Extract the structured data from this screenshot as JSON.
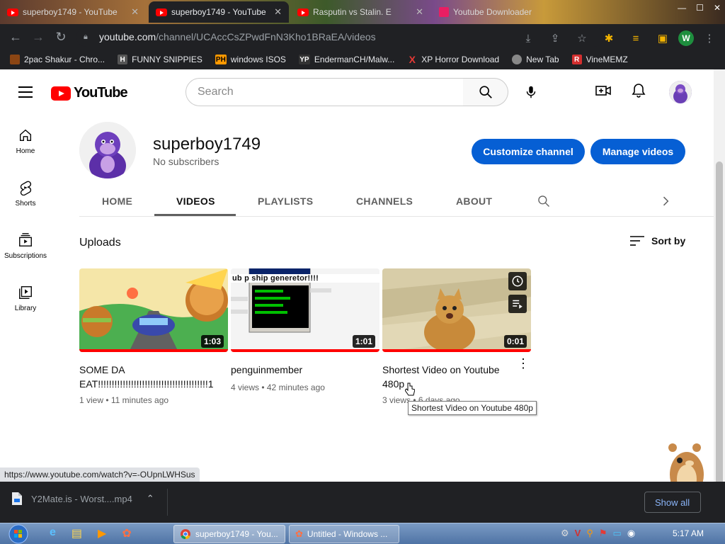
{
  "browser": {
    "tabs": [
      {
        "label": "superboy1749 - YouTube",
        "active": false
      },
      {
        "label": "superboy1749 - YouTube",
        "active": true
      },
      {
        "label": "Rasputin vs Stalin. E",
        "active": false
      },
      {
        "label": "Youtube Downloader",
        "active": false
      }
    ],
    "url_host": "youtube.com",
    "url_path": "/channel/UCAccCsZPwdFnN3Kho1BRaEA/videos",
    "profile_initial": "W",
    "bookmarks": [
      {
        "label": "2pac Shakur - Chro...",
        "icon_text": "",
        "color": "#8b4513"
      },
      {
        "label": "FUNNY SNIPPIES",
        "icon_text": "H",
        "color": "#555555"
      },
      {
        "label": "windows ISOS",
        "icon_text": "PH",
        "color": "#ff9900"
      },
      {
        "label": "EndermanCH/Malw...",
        "icon_text": "YP",
        "color": "#333333"
      },
      {
        "label": "XP Horror Download",
        "icon_text": "X",
        "color": "#cc0000"
      },
      {
        "label": "New Tab",
        "icon_text": "",
        "color": "#888888"
      },
      {
        "label": "VineMEMZ",
        "icon_text": "R",
        "color": "#d32f2f"
      }
    ]
  },
  "youtube": {
    "logo_text": "YouTube",
    "search_placeholder": "Search",
    "sidebar": [
      {
        "label": "Home",
        "icon": "home-icon"
      },
      {
        "label": "Shorts",
        "icon": "shorts-icon"
      },
      {
        "label": "Subscriptions",
        "icon": "subscriptions-icon"
      },
      {
        "label": "Library",
        "icon": "library-icon"
      }
    ],
    "channel": {
      "name": "superboy1749",
      "subscribers": "No subscribers",
      "customize_label": "Customize channel",
      "manage_label": "Manage videos"
    },
    "tabs": [
      "HOME",
      "VIDEOS",
      "PLAYLISTS",
      "CHANNELS",
      "ABOUT"
    ],
    "selected_tab": "VIDEOS",
    "uploads_label": "Uploads",
    "sort_label": "Sort by",
    "videos": [
      {
        "title_line1": "SOME DA",
        "title_line2": "EAT!!!!!!!!!!!!!!!!!!!!!!!!!!!!!!!!!!!!!!!!1",
        "meta": "1 view • 11 minutes ago",
        "duration": "1:03"
      },
      {
        "title_line1": "penguinmember",
        "title_line2": "",
        "meta": "4 views • 42 minutes ago",
        "duration": "1:01",
        "thumb_text": "ub p       ship generetor!!!!"
      },
      {
        "title_line1": "Shortest Video on Youtube",
        "title_line2": "480p",
        "meta": "3 views • 6 days ago",
        "duration": "0:01"
      }
    ],
    "tooltip": "Shortest Video on Youtube 480p",
    "status_url": "https://www.youtube.com/watch?v=-OUpnLWHSus"
  },
  "downloads": {
    "item": "Y2Mate.is - Worst....mp4",
    "show_all": "Show all"
  },
  "taskbar": {
    "tasks": [
      "superboy1749 - You...",
      "Untitled - Windows ..."
    ],
    "clock": "5:17 AM"
  }
}
